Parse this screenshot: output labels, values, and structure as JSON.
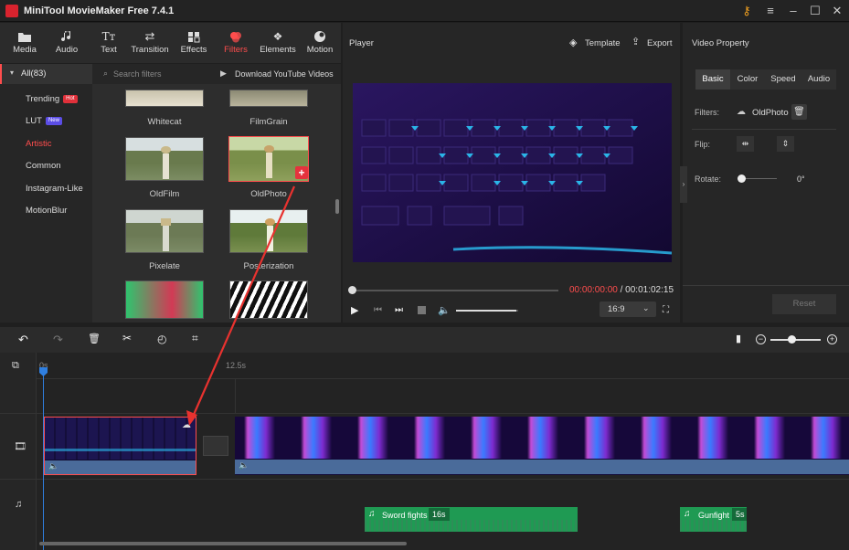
{
  "app": {
    "title": "MiniTool MovieMaker Free 7.4.1"
  },
  "toolbox": {
    "tabs": [
      {
        "label": "Media",
        "icon": "media-icon"
      },
      {
        "label": "Audio",
        "icon": "audio-icon"
      },
      {
        "label": "Text",
        "icon": "text-icon"
      },
      {
        "label": "Transition",
        "icon": "transition-icon"
      },
      {
        "label": "Effects",
        "icon": "effects-icon"
      },
      {
        "label": "Filters",
        "icon": "filters-icon"
      },
      {
        "label": "Elements",
        "icon": "elements-icon"
      },
      {
        "label": "Motion",
        "icon": "motion-icon"
      }
    ],
    "active": "Filters"
  },
  "filters": {
    "all_label": "All(83)",
    "search_placeholder": "Search filters",
    "download_label": "Download YouTube Videos",
    "categories": [
      {
        "label": "Trending",
        "badge": "Hot"
      },
      {
        "label": "LUT",
        "badge": "New"
      },
      {
        "label": "Artistic"
      },
      {
        "label": "Common"
      },
      {
        "label": "Instagram-Like"
      },
      {
        "label": "MotionBlur"
      }
    ],
    "active_category": "Artistic",
    "items": [
      "Whitecat",
      "FilmGrain",
      "OldFilm",
      "OldPhoto",
      "Pixelate",
      "Posterization"
    ],
    "selected": "OldPhoto"
  },
  "player": {
    "title": "Player",
    "template_label": "Template",
    "export_label": "Export",
    "current_time": "00:00:00:00",
    "separator": " / ",
    "total_time": "00:01:02:15",
    "aspect": "16:9",
    "volume": 0.97
  },
  "video_property": {
    "title": "Video Property",
    "tabs": [
      "Basic",
      "Color",
      "Speed",
      "Audio"
    ],
    "active_tab": "Basic",
    "filters_label": "Filters:",
    "filter_value": "OldPhoto",
    "flip_label": "Flip:",
    "rotate_label": "Rotate:",
    "rotate_value": "0°",
    "reset_label": "Reset"
  },
  "timeline": {
    "ruler": [
      "0s",
      "12.5s"
    ],
    "audio_clips": [
      {
        "name": "Sword fights",
        "duration": "16s"
      },
      {
        "name": "Gunfight",
        "duration": "5s"
      }
    ]
  },
  "colors": {
    "accent": "#ff4d4d",
    "audio_clip": "#1f9a53",
    "video_bar": "#4a6b9a"
  }
}
